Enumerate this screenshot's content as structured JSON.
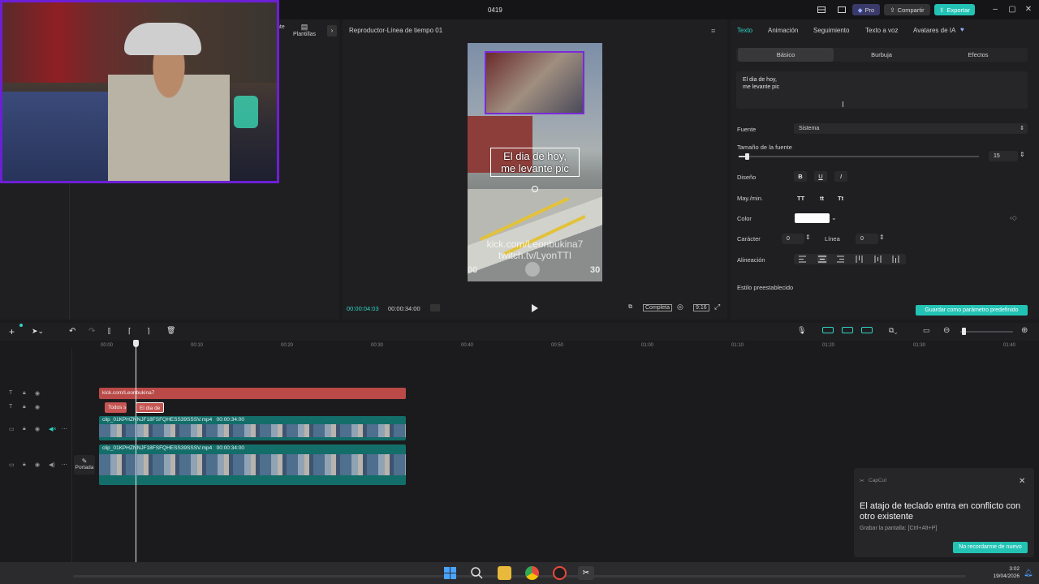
{
  "window": {
    "title": "0419",
    "pro_label": "Pro",
    "share_label": "Compartir",
    "export_label": "Exportar"
  },
  "left_panel": {
    "partial_tab": "nte",
    "templates_label": "Plantillas"
  },
  "player": {
    "title": "Reproductor-Línea de tiempo 01",
    "caption_line1": "El dia de hoy,",
    "caption_line2": "me levante pic",
    "watermark_line1": "kick.com/Leonbukina7",
    "watermark_line2": "twitch.tv/LyonTTI",
    "corner_left": "00",
    "corner_right": "30",
    "current_time": "00:00:04:03",
    "total_time": "00:00:34:00",
    "full_label": "Completa",
    "ratio_label": "9:16"
  },
  "properties": {
    "tabs": [
      "Texto",
      "Animación",
      "Seguimiento",
      "Texto a voz",
      "Avatares de IA"
    ],
    "subtabs": [
      "Básico",
      "Burbuja",
      "Efectos"
    ],
    "text_value": "El dia de hoy,\nme levante pic",
    "font_label": "Fuente",
    "font_value": "Sistema",
    "font_size_label": "Tamaño de la fuente",
    "font_size_value": "15",
    "font_size_fraction": 0.03,
    "design_label": "Diseño",
    "case_label": "May./min.",
    "case_options": [
      "TT",
      "tt",
      "Tt"
    ],
    "color_label": "Color",
    "color_value": "#ffffff",
    "char_label": "Carácter",
    "char_value": "0",
    "line_label": "Línea",
    "line_value": "0",
    "align_label": "Alineación",
    "preset_label": "Estilo preestablecido",
    "save_default_label": "Guardar como parámetro predefinido"
  },
  "timeline": {
    "ruler": [
      "00:00",
      "00:10",
      "00:20",
      "00:30",
      "00:40",
      "00:50",
      "01:00",
      "01:10",
      "01:20",
      "01:30",
      "01:40"
    ],
    "text_clip": "kick.com/Leonbukina7",
    "small_clip1": "Todos s",
    "small_clip2": "El dia de",
    "video_clip1_name": "clip_01KPHZNNJF18FSFQHESS39SSSV.mp4",
    "video_clip1_dur": "00:00:34:00",
    "video_clip2_name": "clip_01KPHZNNJF18FSFQHESS39SSSV.mp4",
    "video_clip2_dur": "00:00:34:00",
    "cover_label": "Portada"
  },
  "toast": {
    "app": "CapCut",
    "message": "El atajo de teclado entra en conflicto con otro existente",
    "sub": "Grabar la pantalla: [Ctrl+Alt+P]",
    "button": "No recordarme de nuevo"
  },
  "taskbar": {
    "time": "3:02",
    "date": "19/04/2026"
  },
  "colors": {
    "accent": "#2fd3c5",
    "webcam_border": "#6d1fd6",
    "text_clip": "#b94a48",
    "video_clip": "#136e6a"
  }
}
